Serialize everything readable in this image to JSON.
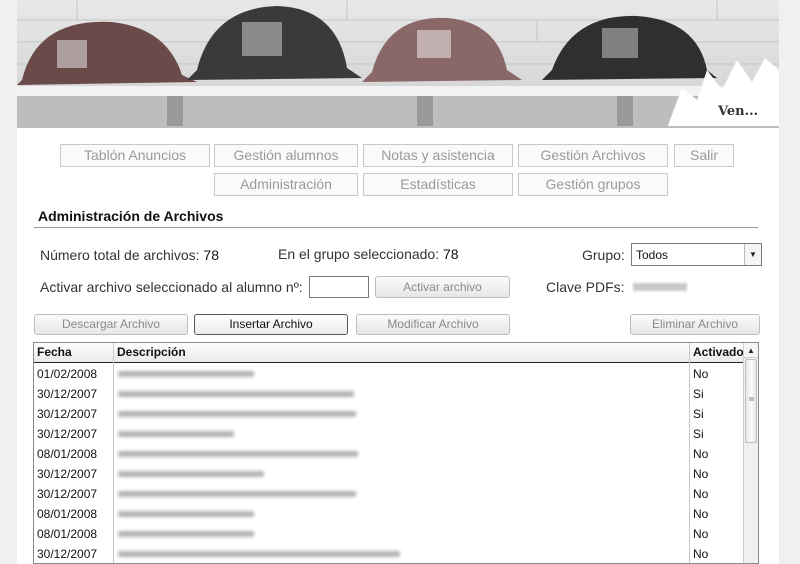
{
  "banner": {
    "text": "Ven..."
  },
  "nav": {
    "row1": [
      "Tablón Anuncios",
      "Gestión alumnos",
      "Notas y asistencia",
      "Gestión Archivos",
      "Salir"
    ],
    "row2": [
      "Administración",
      "Estadísticas",
      "Gestión grupos"
    ]
  },
  "section": {
    "title": "Administración de Archivos"
  },
  "stats": {
    "total_label": "Número total de archivos:",
    "total_value": "78",
    "group_label": "En el grupo seleccionado:",
    "group_value": "78",
    "grupo_label": "Grupo:",
    "grupo_selected": "Todos",
    "activate_label": "Activar archivo seleccionado al alumno nº:",
    "activate_button": "Activar archivo",
    "clave_label": "Clave PDFs:"
  },
  "toolbar": {
    "download": "Descargar Archivo",
    "insert": "Insertar Archivo",
    "modify": "Modificar Archivo",
    "delete": "Eliminar Archivo"
  },
  "table": {
    "headers": {
      "fecha": "Fecha",
      "descripcion": "Descripción",
      "activado": "Activado"
    },
    "rows": [
      {
        "fecha": "01/02/2008",
        "activado": "No"
      },
      {
        "fecha": "30/12/2007",
        "activado": "Si"
      },
      {
        "fecha": "30/12/2007",
        "activado": "Si"
      },
      {
        "fecha": "30/12/2007",
        "activado": "Si"
      },
      {
        "fecha": "08/01/2008",
        "activado": "No"
      },
      {
        "fecha": "30/12/2007",
        "activado": "No"
      },
      {
        "fecha": "30/12/2007",
        "activado": "No"
      },
      {
        "fecha": "08/01/2008",
        "activado": "No"
      },
      {
        "fecha": "08/01/2008",
        "activado": "No"
      },
      {
        "fecha": "30/12/2007",
        "activado": "No"
      }
    ]
  }
}
